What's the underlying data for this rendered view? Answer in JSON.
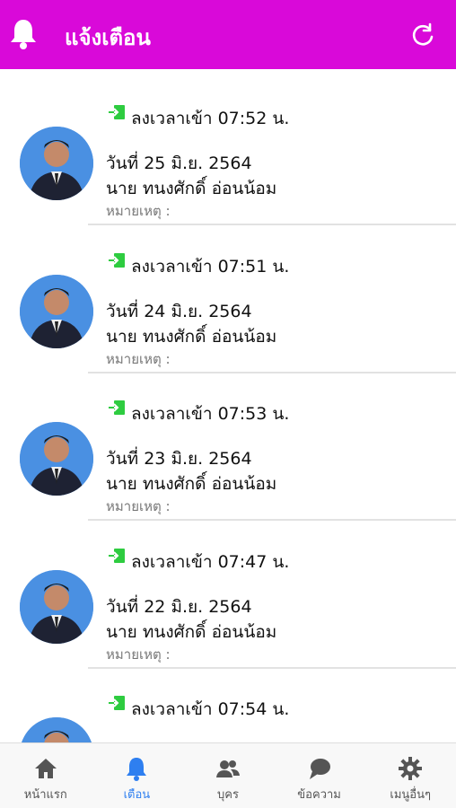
{
  "header": {
    "title": "แจ้งเตือน",
    "icon": "bell-icon",
    "action_icon": "refresh-icon"
  },
  "notifications": [
    {
      "line1": "ลงเวลาเข้า 07:52 น.",
      "date": "วันที่ 25 มิ.ย. 2564",
      "name": "นาย ทนงศักดิ์ อ่อนน้อม",
      "note": "หมายเหตุ :"
    },
    {
      "line1": "ลงเวลาเข้า 07:51 น.",
      "date": "วันที่ 24 มิ.ย. 2564",
      "name": "นาย ทนงศักดิ์ อ่อนน้อม",
      "note": "หมายเหตุ :"
    },
    {
      "line1": "ลงเวลาเข้า 07:53 น.",
      "date": "วันที่ 23 มิ.ย. 2564",
      "name": "นาย ทนงศักดิ์ อ่อนน้อม",
      "note": "หมายเหตุ :"
    },
    {
      "line1": "ลงเวลาเข้า 07:47 น.",
      "date": "วันที่ 22 มิ.ย. 2564",
      "name": "นาย ทนงศักดิ์ อ่อนน้อม",
      "note": "หมายเหตุ :"
    },
    {
      "line1": "ลงเวลาเข้า 07:54 น.",
      "date": "",
      "name": "",
      "note": ""
    }
  ],
  "tabs": [
    {
      "label": "หน้าแรก",
      "icon": "home-icon",
      "active": false
    },
    {
      "label": "เตือน",
      "icon": "bell-icon",
      "active": true
    },
    {
      "label": "บุคร",
      "icon": "people-icon",
      "active": false
    },
    {
      "label": "ข้อความ",
      "icon": "chat-icon",
      "active": false
    },
    {
      "label": "เมนูอื่นๆ",
      "icon": "gear-icon",
      "active": false
    }
  ],
  "colors": {
    "header": "#d909d9",
    "active_tab": "#2e7ff0",
    "tab_icon": "#555555",
    "login_icon": "#2ecc40"
  }
}
